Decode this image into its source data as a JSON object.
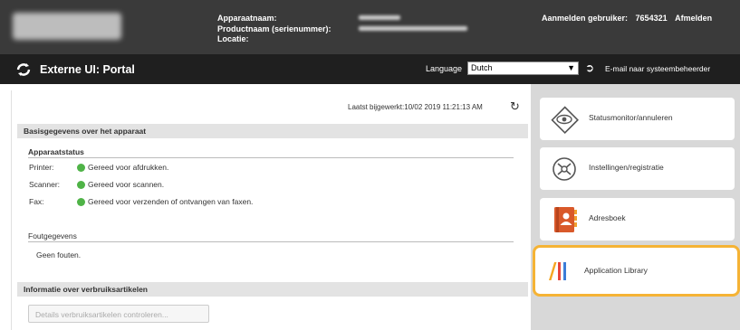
{
  "header": {
    "device_name_label": "Apparaatnaam:",
    "product_name_label": "Productnaam (serienummer):",
    "location_label": "Locatie:",
    "logged_in_label": "Aanmelden gebruiker:",
    "user_id": "7654321",
    "logout_label": "Afmelden"
  },
  "titlebar": {
    "title": "Externe UI: Portal",
    "language_label": "Language",
    "language_value": "Dutch",
    "mail_link": "E-mail naar systeembeheerder"
  },
  "main": {
    "last_updated": "Laatst bijgewerkt:10/02 2019 11:21:13 AM",
    "basic_info_header": "Basisgegevens over het apparaat",
    "device_status_title": "Apparaatstatus",
    "status_rows": [
      {
        "label": "Printer:",
        "status": "Gereed voor afdrukken."
      },
      {
        "label": "Scanner:",
        "status": "Gereed voor scannen."
      },
      {
        "label": "Fax:",
        "status": "Gereed voor verzenden of ontvangen van faxen."
      }
    ],
    "error_info_title": "Foutgegevens",
    "error_info_value": "Geen fouten.",
    "consumables_header": "Informatie over verbruiksartikelen",
    "consumables_button": "Details verbruiksartikelen controleren..."
  },
  "sidebar": {
    "items": [
      {
        "label": "Statusmonitor/annuleren",
        "icon": "status-monitor-icon"
      },
      {
        "label": "Instellingen/registratie",
        "icon": "settings-registration-icon"
      },
      {
        "label": "Adresboek",
        "icon": "address-book-icon"
      },
      {
        "label": "Application Library",
        "icon": "application-library-icon",
        "highlighted": true
      }
    ]
  },
  "colors": {
    "status_ready": "#4fb347",
    "highlight": "#f5b335",
    "header_bg": "#3a3a3a",
    "titlebar_bg": "#1f1f1f"
  }
}
